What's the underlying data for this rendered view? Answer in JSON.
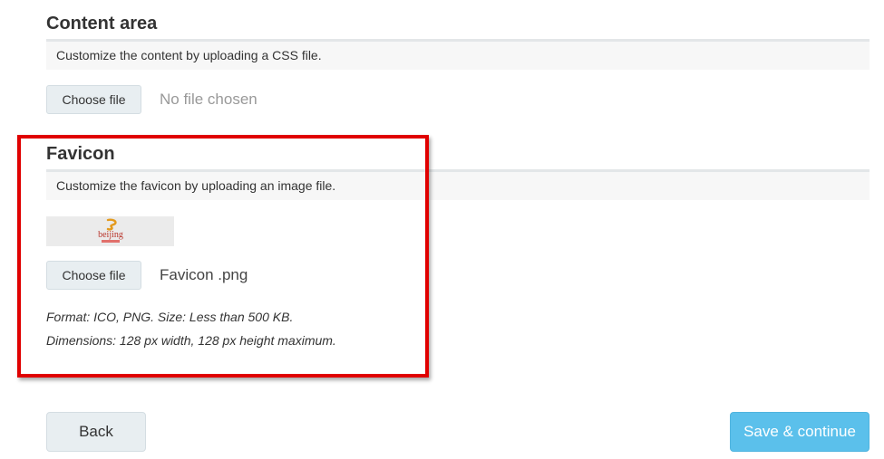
{
  "content_area": {
    "title": "Content area",
    "description": "Customize the content by uploading a CSS file.",
    "choose_file_label": "Choose file",
    "file_status": "No file chosen"
  },
  "favicon": {
    "title": "Favicon",
    "description": "Customize the favicon by uploading an image file.",
    "preview_logo_text": "beijing",
    "choose_file_label": "Choose file",
    "file_status": "Favicon .png",
    "format_hint": "Format: ICO, PNG. Size: Less than 500 KB.",
    "dimensions_hint": "Dimensions: 128 px width, 128 px height maximum."
  },
  "footer": {
    "back_label": "Back",
    "save_label": "Save & continue"
  },
  "colors": {
    "highlight": "#e00000",
    "primary": "#5bc0eb",
    "secondary": "#e8eef1"
  }
}
